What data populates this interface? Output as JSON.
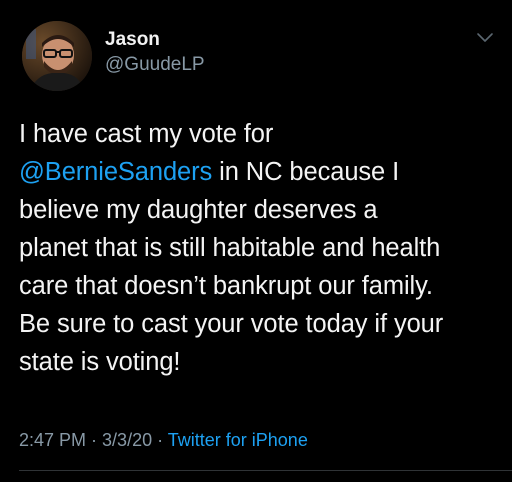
{
  "author": {
    "name": "Jason",
    "handle": "@GuudeLP",
    "avatar_icon": "profile-photo"
  },
  "tweet": {
    "line1": "I have cast my vote for",
    "mention": "@BernieSanders",
    "line2_rest": " in NC because I",
    "line3": "believe my daughter deserves a",
    "line4": "planet that is still habitable and health",
    "line5": "care that doesn’t bankrupt our family.",
    "line6": "Be sure to cast your vote today if your",
    "line7": "state is voting!"
  },
  "meta": {
    "time": "2:47 PM",
    "sep1": " · ",
    "date": "3/3/20",
    "sep2": " · ",
    "source": "Twitter for iPhone"
  },
  "icons": {
    "menu": "chevron-down-icon"
  },
  "colors": {
    "background": "#000000",
    "link": "#1da1f2",
    "secondary_text": "#8899a6",
    "primary_text": "#ffffff"
  }
}
